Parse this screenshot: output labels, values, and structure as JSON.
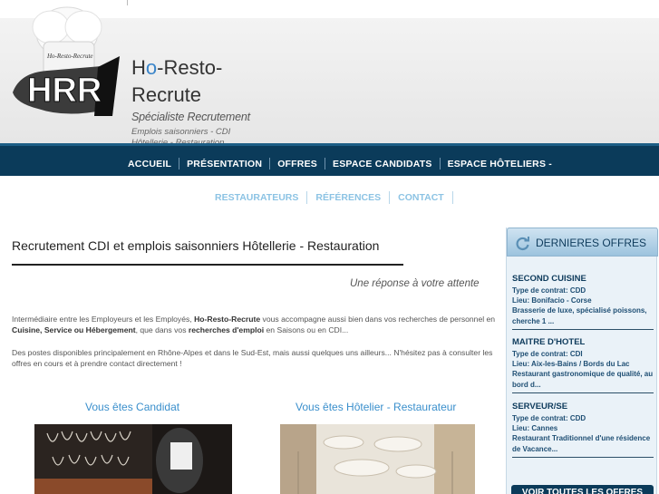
{
  "header": {
    "brand_a": "H",
    "brand_o": "o",
    "brand_b": "-Resto-",
    "brand_line2": "Recrute",
    "tagline": "Spécialiste Recrutement",
    "subline1": "Emplois saisonniers - CDI",
    "subline2": "Hôtellerie - Restauration",
    "logo_text": "HRR",
    "logo_small": "Ho-Resto-Recrute"
  },
  "nav": {
    "items": [
      "ACCUEIL",
      "PRÉSENTATION",
      "OFFRES",
      "ESPACE CANDIDATS",
      "ESPACE HÔTELIERS -"
    ]
  },
  "subnav": {
    "items": [
      "RESTAURATEURS",
      "RÉFÉRENCES",
      "CONTACT"
    ]
  },
  "main": {
    "title": "Recrutement CDI et emplois saisonniers Hôtellerie - Restauration",
    "tagline": "Une réponse à votre attente",
    "p1_a": "Intermédiaire entre les Employeurs et les Employés, ",
    "p1_b": "Ho-Resto-Recrute",
    "p1_c": " vous accompagne aussi bien dans vos recherches de personnel en ",
    "p1_d": "Cuisine, Service ou Hébergement",
    "p1_e": ", que dans vos ",
    "p1_f": "recherches d'emploi",
    "p1_g": " en Saisons ou en CDI...",
    "p2": "Des postes disponibles principalement en Rhône-Alpes et dans le Sud-Est, mais aussi quelques uns ailleurs... N'hésitez pas à consulter les offres en cours et à prendre contact directement !",
    "col1_title": "Vous êtes Candidat",
    "col2_title": "Vous êtes Hôtelier - Restaurateur"
  },
  "sidebar": {
    "title": "DERNIERES OFFRES",
    "button": "VOIR TOUTES LES OFFRES",
    "offers": [
      {
        "title": "SECOND CUISINE",
        "contract": "Type de contrat: CDD",
        "place": "Lieu: Bonifacio - Corse",
        "desc": "Brasserie de luxe, spécialisé poissons, cherche 1 ..."
      },
      {
        "title": "MAITRE D'HOTEL",
        "contract": "Type de contrat: CDI",
        "place": "Lieu: Aix-les-Bains / Bords du Lac",
        "desc": "Restaurant gastronomique de qualité, au bord d..."
      },
      {
        "title": "SERVEUR/SE",
        "contract": "Type de contrat: CDD",
        "place": "Lieu: Cannes",
        "desc": "Restaurant Traditionnel d'une résidence de Vacance..."
      }
    ]
  },
  "colors": {
    "nav_bg": "#0b3b5a",
    "link_blue": "#3a8fcc",
    "subnav_blue": "#8cc3e4"
  }
}
